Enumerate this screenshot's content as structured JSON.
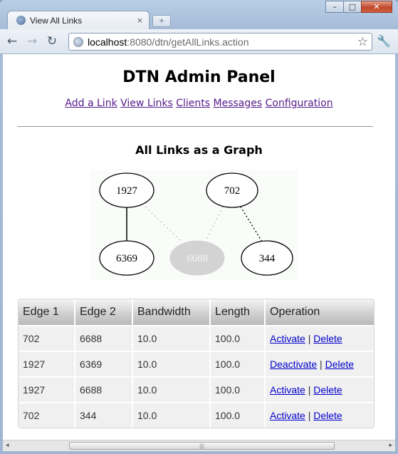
{
  "window": {
    "tab_title": "View All Links",
    "tab_close": "×",
    "new_tab": "+",
    "minimize": "–",
    "maximize": "□",
    "close": "✕"
  },
  "toolbar": {
    "back": "←",
    "forward": "→",
    "reload": "↻",
    "url_host": "localhost",
    "url_path": ":8080/dtn/getAllLinks.action",
    "star": "☆",
    "wrench": "🔧"
  },
  "page": {
    "title": "DTN Admin Panel",
    "nav": [
      "Add a Link",
      "View Links",
      "Clients",
      "Messages",
      "Configuration"
    ],
    "graph_title": "All Links as a Graph"
  },
  "graph": {
    "nodes": [
      {
        "label": "1927",
        "active": true
      },
      {
        "label": "702",
        "active": true
      },
      {
        "label": "6369",
        "active": true
      },
      {
        "label": "6688",
        "active": false
      },
      {
        "label": "344",
        "active": true
      }
    ],
    "edges": [
      {
        "from": "1927",
        "to": "6369",
        "style": "solid"
      },
      {
        "from": "1927",
        "to": "6688",
        "style": "faded-dotted"
      },
      {
        "from": "702",
        "to": "6688",
        "style": "faded-dotted"
      },
      {
        "from": "702",
        "to": "344",
        "style": "dotted"
      }
    ]
  },
  "table": {
    "headers": [
      "Edge 1",
      "Edge 2",
      "Bandwidth",
      "Length",
      "Operation"
    ],
    "rows": [
      {
        "edge1": "702",
        "edge2": "6688",
        "bandwidth": "10.0",
        "length": "100.0",
        "action": "Activate",
        "delete": "Delete"
      },
      {
        "edge1": "1927",
        "edge2": "6369",
        "bandwidth": "10.0",
        "length": "100.0",
        "action": "Deactivate",
        "delete": "Delete"
      },
      {
        "edge1": "1927",
        "edge2": "6688",
        "bandwidth": "10.0",
        "length": "100.0",
        "action": "Activate",
        "delete": "Delete"
      },
      {
        "edge1": "702",
        "edge2": "344",
        "bandwidth": "10.0",
        "length": "100.0",
        "action": "Activate",
        "delete": "Delete"
      }
    ],
    "separator": "|"
  },
  "scrollbar": {
    "left": "◂",
    "right": "▸",
    "grip": "|||"
  }
}
